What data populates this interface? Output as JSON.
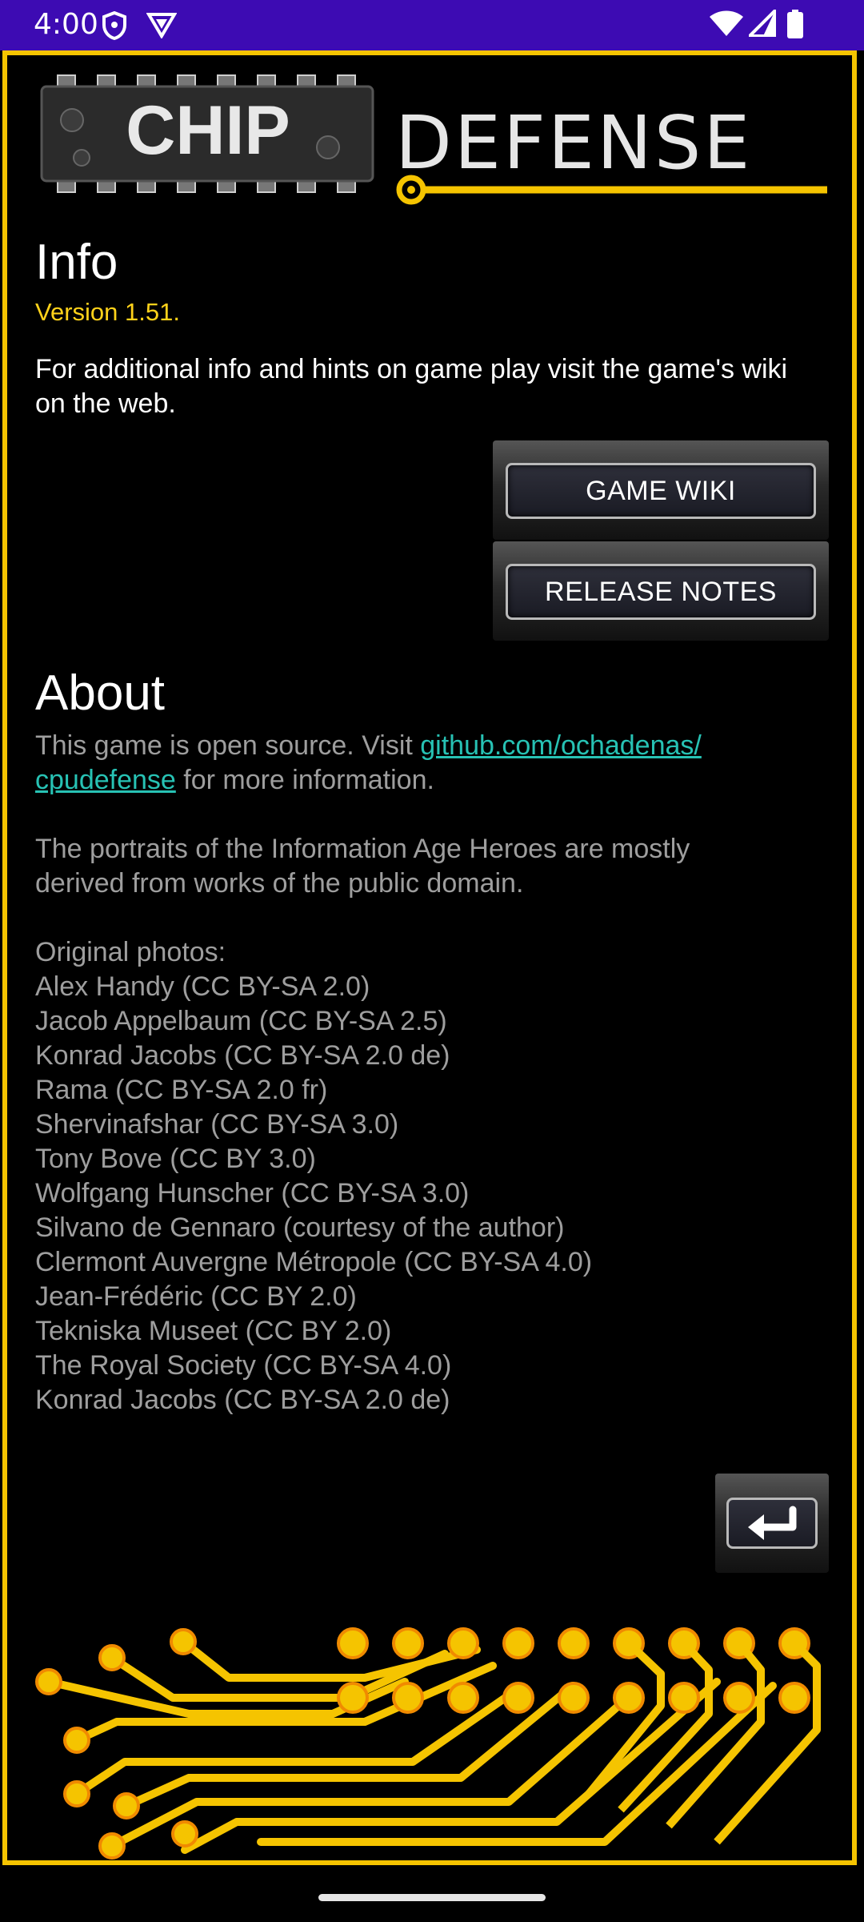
{
  "status_bar": {
    "time": "4:00",
    "icons": [
      "shield-icon",
      "vpn-icon",
      "wifi-icon",
      "signal-icon",
      "battery-icon"
    ]
  },
  "logo": {
    "chip_text": "CHIP",
    "defense_text": "DEFENSE"
  },
  "info": {
    "heading": "Info",
    "version": "Version 1.51.",
    "text": "For additional info and hints on game play visit the game's wiki on the web.",
    "buttons": {
      "wiki": "GAME WIKI",
      "release_notes": "RELEASE NOTES"
    }
  },
  "about": {
    "heading": "About",
    "intro_before": "This game is open source. Visit ",
    "link": "github.com/ochadenas/\ncpudefense",
    "intro_after": " for more information.",
    "portraits": "The portraits of the Information Age Heroes are mostly\nderived from works of the public domain.",
    "photos_title": "Original photos:",
    "photos": [
      " Alex Handy (CC BY-SA 2.0)",
      " Jacob Appelbaum (CC BY-SA 2.5)",
      " Konrad Jacobs (CC BY-SA 2.0 de)",
      " Rama (CC BY-SA 2.0 fr)",
      " Shervinafshar (CC BY-SA 3.0)",
      " Tony Bove (CC BY 3.0)",
      " Wolfgang Hunscher (CC BY-SA 3.0)",
      " Silvano de Gennaro (courtesy of the author)",
      " Clermont Auvergne Métropole (CC BY-SA 4.0)",
      " Jean-Frédéric (CC BY 2.0)",
      " Tekniska Museet (CC BY 2.0)",
      " The Royal Society (CC BY-SA 4.0)",
      " Konrad Jacobs (CC BY-SA 2.0 de)"
    ]
  },
  "colors": {
    "status_bar": "#3d0bb3",
    "frame": "#f5c400",
    "version": "#ffd21a",
    "link": "#27c2b4",
    "muted_text": "#9e9e9e"
  }
}
